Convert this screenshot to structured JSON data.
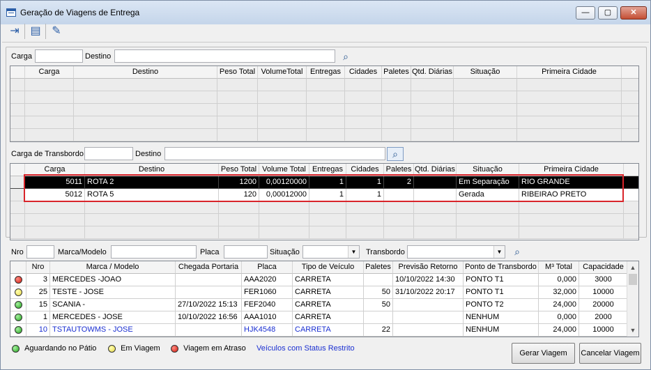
{
  "window": {
    "title": "Geração de Viagens de Entrega"
  },
  "titlebar_buttons": {
    "minimize": "—",
    "maximize": "▢",
    "close": "✕"
  },
  "toolbar": {
    "buttons": [
      {
        "icon": "exit-door-icon",
        "glyph": "⇥"
      },
      {
        "icon": "clipboard-icon",
        "glyph": "▤"
      },
      {
        "icon": "eraser-icon",
        "glyph": "✎"
      }
    ]
  },
  "filter1": {
    "carga_label": "Carga",
    "carga_value": "",
    "destino_label": "Destino",
    "destino_value": "",
    "search_glyph": "⌕"
  },
  "grid1": {
    "columns": [
      "Carga",
      "Destino",
      "Peso Total",
      "VolumeTotal",
      "Entregas",
      "Cidades",
      "Paletes",
      "Qtd. Diárias",
      "Situação",
      "Primeira Cidade"
    ]
  },
  "filter2": {
    "label": "Carga de Transbordo",
    "value": "",
    "destino_label": "Destino",
    "destino_value": "",
    "search_glyph": "⌕"
  },
  "grid2": {
    "columns": [
      "Carga",
      "Destino",
      "Peso Total",
      "Volume Total",
      "Entregas",
      "Cidades",
      "Paletes",
      "Qtd. Diárias",
      "Situação",
      "Primeira Cidade"
    ],
    "rows": [
      {
        "carga": "5011",
        "destino": "ROTA 2",
        "peso": "1200",
        "volume": "0,00120000",
        "entregas": "1",
        "cidades": "1",
        "paletes": "2",
        "diarias": "",
        "situacao": "Em Separação",
        "primeira": "RIO GRANDE"
      },
      {
        "carga": "5012",
        "destino": "ROTA 5",
        "peso": "120",
        "volume": "0,00012000",
        "entregas": "1",
        "cidades": "1",
        "paletes": "",
        "diarias": "",
        "situacao": "Gerada",
        "primeira": "RIBEIRAO PRETO"
      }
    ]
  },
  "filter3": {
    "nro_label": "Nro",
    "nro_value": "",
    "marca_label": "Marca/Modelo",
    "marca_value": "",
    "placa_label": "Placa",
    "placa_value": "",
    "situacao_label": "Situação",
    "situacao_value": "",
    "transbordo_label": "Transbordo",
    "transbordo_value": "",
    "dropdown_glyph": "▼",
    "search_glyph": "⌕"
  },
  "grid3": {
    "columns": [
      "Nro",
      "Marca / Modelo",
      "Chegada Portaria",
      "Placa",
      "Tipo de Veículo",
      "Paletes",
      "Previsão Retorno",
      "Ponto de Transbordo",
      "M³ Total",
      "Capacidade"
    ],
    "rows": [
      {
        "status": "red",
        "nro": "3",
        "marca": "MERCEDES -JOAO",
        "chegada": "",
        "placa": "AAA2020",
        "tipo": "CARRETA",
        "paletes": "",
        "previsao": "10/10/2022 14:30",
        "ponto": "PONTO T1",
        "m3": "0,000",
        "capacidade": "3000",
        "restricted": false
      },
      {
        "status": "yellow",
        "nro": "25",
        "marca": "TESTE - JOSE",
        "chegada": "",
        "placa": "FER1060",
        "tipo": "CARRETA",
        "paletes": "50",
        "previsao": "31/10/2022 20:17",
        "ponto": "PONTO T1",
        "m3": "32,000",
        "capacidade": "10000",
        "restricted": false
      },
      {
        "status": "green",
        "nro": "15",
        "marca": "SCANIA -",
        "chegada": "27/10/2022 15:13",
        "placa": "FEF2040",
        "tipo": "CARRETA",
        "paletes": "50",
        "previsao": "",
        "ponto": "PONTO T2",
        "m3": "24,000",
        "capacidade": "20000",
        "restricted": false
      },
      {
        "status": "green",
        "nro": "1",
        "marca": "MERCEDES - JOSE",
        "chegada": "10/10/2022 16:56",
        "placa": "AAA1010",
        "tipo": "CARRETA",
        "paletes": "",
        "previsao": "",
        "ponto": "NENHUM",
        "m3": "0,000",
        "capacidade": "2000",
        "restricted": false
      },
      {
        "status": "green",
        "nro": "10",
        "marca": "TSTAUTOWMS - JOSE",
        "chegada": "",
        "placa": "HJK4548",
        "tipo": "CARRETA",
        "paletes": "22",
        "previsao": "",
        "ponto": "NENHUM",
        "m3": "24,000",
        "capacidade": "10000",
        "restricted": true
      }
    ],
    "scroll_up": "▲",
    "scroll_down": "▼"
  },
  "legend": {
    "aguardando": "Aguardando no Pátio",
    "em_viagem": "Em Viagem",
    "em_atraso": "Viagem em Atraso",
    "restrito": "Veículos com Status Restrito"
  },
  "buttons": {
    "gerar": "Gerar Viagem",
    "cancelar": "Cancelar Viagem"
  },
  "colors": {
    "highlight": "#d9242a",
    "selected_row": "#000000",
    "restricted_text": "#1a2fd1"
  }
}
